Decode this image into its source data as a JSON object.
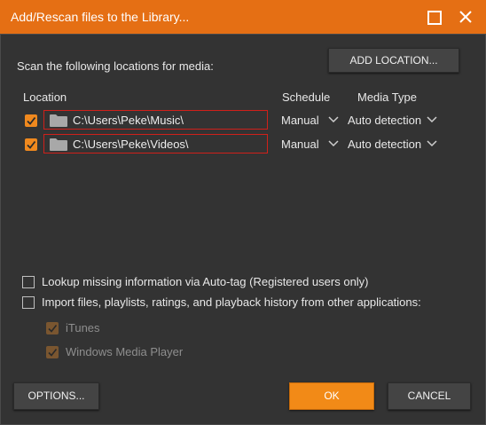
{
  "window": {
    "title": "Add/Rescan files to the Library...",
    "accent_color": "#e56f14"
  },
  "scan_label": "Scan the following locations for media:",
  "add_location_label": "ADD LOCATION...",
  "columns": {
    "location": "Location",
    "schedule": "Schedule",
    "media_type": "Media Type"
  },
  "locations": [
    {
      "checked": true,
      "path": "C:\\Users\\Peke\\Music\\",
      "schedule": "Manual",
      "media_type": "Auto detection"
    },
    {
      "checked": true,
      "path": "C:\\Users\\Peke\\Videos\\",
      "schedule": "Manual",
      "media_type": "Auto detection"
    }
  ],
  "options": {
    "autotag_label": "Lookup missing information via Auto-tag (Registered users only)",
    "autotag_checked": false,
    "import_label": "Import files, playlists, ratings, and playback history from other applications:",
    "import_checked": false,
    "sources": [
      {
        "label": "iTunes",
        "checked": true
      },
      {
        "label": "Windows Media Player",
        "checked": true
      }
    ]
  },
  "buttons": {
    "options": "OPTIONS...",
    "ok": "OK",
    "cancel": "CANCEL"
  }
}
